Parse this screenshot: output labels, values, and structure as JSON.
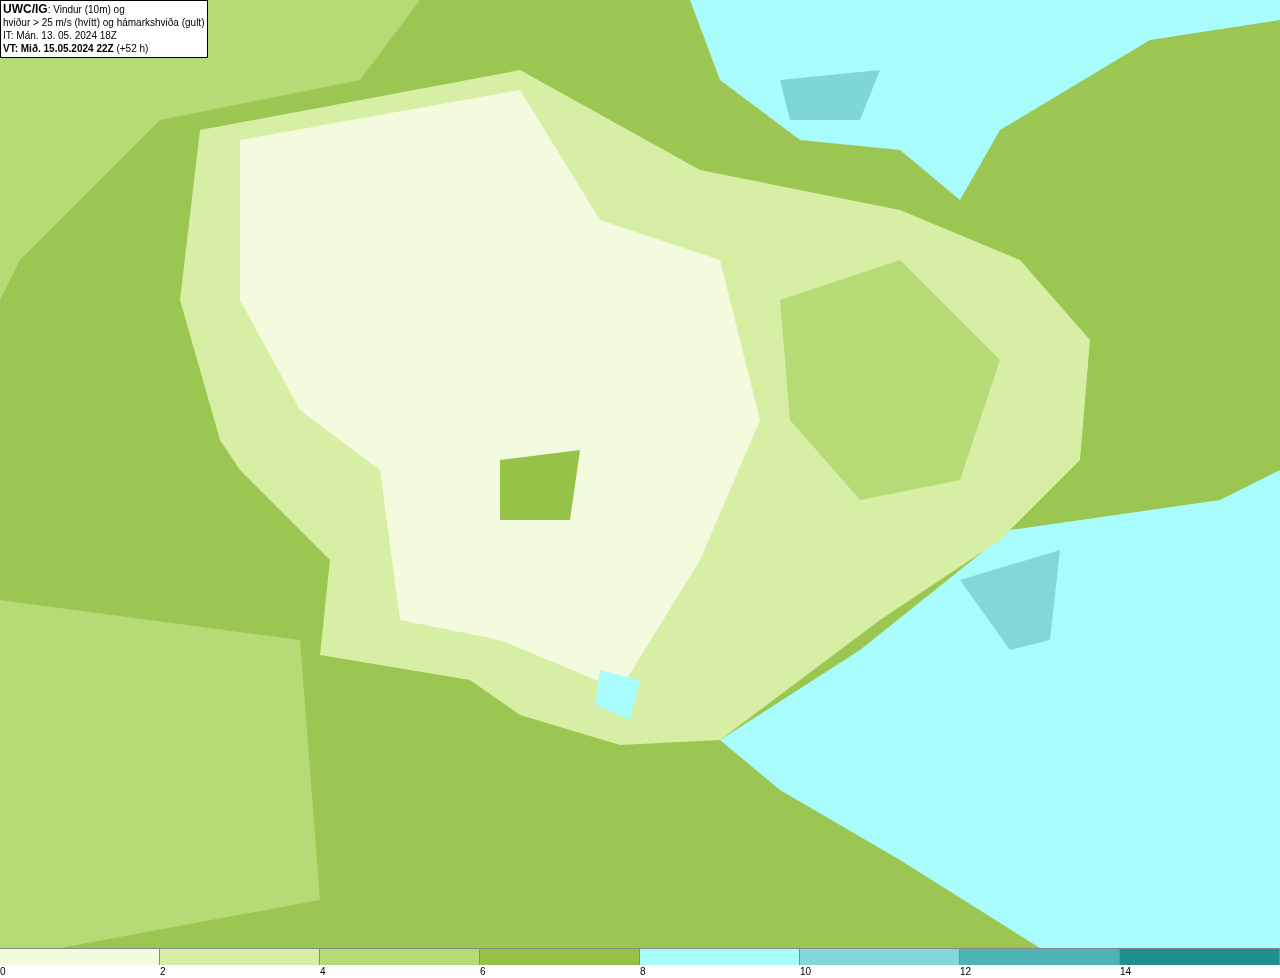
{
  "info_box": {
    "lines": [
      "**UWC/IG**: Vindur (10m) og",
      "hviður > 25 m/s (hvítt) og hámarkshviða (gult)",
      "IT: Mán. 13. 05. 2024 18Z",
      "**VT: Mið. 15.05.2024 22Z** (+52 h)"
    ]
  },
  "legend": {
    "bins": [
      {
        "color": "#f3fbdf"
      },
      {
        "color": "#d6efa5"
      },
      {
        "color": "#b6da75"
      },
      {
        "color": "#96c248"
      },
      {
        "color": "#a8fcfc"
      },
      {
        "color": "#82d8d8"
      },
      {
        "color": "#4fb3b3"
      },
      {
        "color": "#21908c"
      }
    ],
    "labels": [
      "0",
      "2",
      "4",
      "6",
      "8",
      "10",
      "12",
      "14"
    ]
  }
}
